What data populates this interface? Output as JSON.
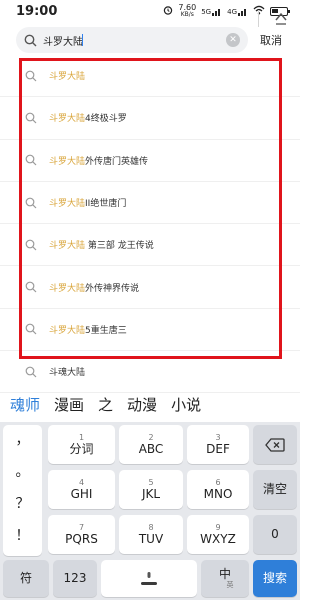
{
  "status": {
    "time": "19:00",
    "net_speed": "7.60",
    "net_unit": "KB/s",
    "network_1": "5G",
    "network_2": "4G",
    "battery_level": 0.45
  },
  "search": {
    "value": "斗罗大陆",
    "cancel_label": "取消"
  },
  "suggestions": [
    {
      "highlight": "斗罗大陆",
      "rest": ""
    },
    {
      "highlight": "斗罗大陆",
      "rest": "4终极斗罗"
    },
    {
      "highlight": "斗罗大陆",
      "rest": "外传唐门英雄传"
    },
    {
      "highlight": "斗罗大陆",
      "rest": "II绝世唐门"
    },
    {
      "highlight": "斗罗大陆",
      "rest": " 第三部 龙王传说"
    },
    {
      "highlight": "斗罗大陆",
      "rest": "外传神界传说"
    },
    {
      "highlight": "斗罗大陆",
      "rest": "5重生唐三"
    },
    {
      "highlight": "",
      "rest": "斗魂大陆"
    }
  ],
  "candidates": [
    "魂师",
    "漫画",
    "之",
    "动漫",
    "小说"
  ],
  "keyboard": {
    "symbols": [
      "，",
      "。",
      "？",
      "！"
    ],
    "row1": [
      {
        "digit": "1",
        "letters": "分词"
      },
      {
        "digit": "2",
        "letters": "ABC"
      },
      {
        "digit": "3",
        "letters": "DEF"
      }
    ],
    "row2": [
      {
        "digit": "4",
        "letters": "GHI"
      },
      {
        "digit": "5",
        "letters": "JKL"
      },
      {
        "digit": "6",
        "letters": "MNO"
      }
    ],
    "row3": [
      {
        "digit": "7",
        "letters": "PQRS"
      },
      {
        "digit": "8",
        "letters": "TUV"
      },
      {
        "digit": "9",
        "letters": "WXYZ"
      }
    ],
    "clear_label": "清空",
    "zero_label": "0",
    "symbol_key_label": "符",
    "number_key_label": "123",
    "lang_key_label": "中",
    "lang_key_sub": "英",
    "search_key_label": "搜索"
  },
  "colors": {
    "highlight": "#d9a53a",
    "accent_blue": "#2f7fd9",
    "annotation_red": "#e0141b"
  }
}
